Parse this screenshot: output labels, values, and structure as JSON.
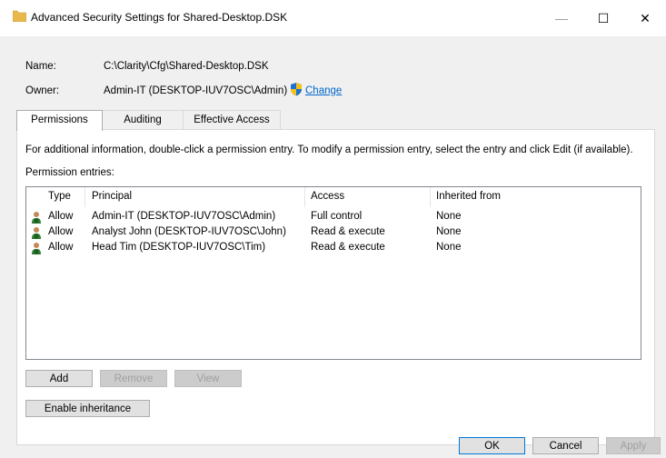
{
  "window": {
    "title": "Advanced Security Settings for Shared-Desktop.DSK",
    "minimize_glyph": "—",
    "maximize_glyph": "☐",
    "close_glyph": "✕"
  },
  "info": {
    "name_label": "Name:",
    "name_value": "C:\\Clarity\\Cfg\\Shared-Desktop.DSK",
    "owner_label": "Owner:",
    "owner_value": "Admin-IT (DESKTOP-IUV7OSC\\Admin)",
    "change_link": "Change"
  },
  "tabs": [
    {
      "label": "Permissions",
      "active": true
    },
    {
      "label": "Auditing",
      "active": false
    },
    {
      "label": "Effective Access",
      "active": false
    }
  ],
  "permissions": {
    "info_text": "For additional information, double-click a permission entry. To modify a permission entry, select the entry and click Edit (if available).",
    "entries_label": "Permission entries:",
    "columns": [
      "Type",
      "Principal",
      "Access",
      "Inherited from"
    ],
    "rows": [
      {
        "type": "Allow",
        "principal": "Admin-IT (DESKTOP-IUV7OSC\\Admin)",
        "access": "Full control",
        "inherited": "None"
      },
      {
        "type": "Allow",
        "principal": "Analyst John (DESKTOP-IUV7OSC\\John)",
        "access": "Read & execute",
        "inherited": "None"
      },
      {
        "type": "Allow",
        "principal": "Head Tim (DESKTOP-IUV7OSC\\Tim)",
        "access": "Read & execute",
        "inherited": "None"
      }
    ],
    "buttons": {
      "add": "Add",
      "remove": "Remove",
      "view": "View",
      "enable_inheritance": "Enable inheritance"
    }
  },
  "footer": {
    "ok": "OK",
    "cancel": "Cancel",
    "apply": "Apply"
  },
  "colors": {
    "link": "#0066cc",
    "accent_border": "#0078d7",
    "folder": "#e8b94a"
  },
  "icons": [
    "folder-icon",
    "shield-icon",
    "user-icon"
  ]
}
